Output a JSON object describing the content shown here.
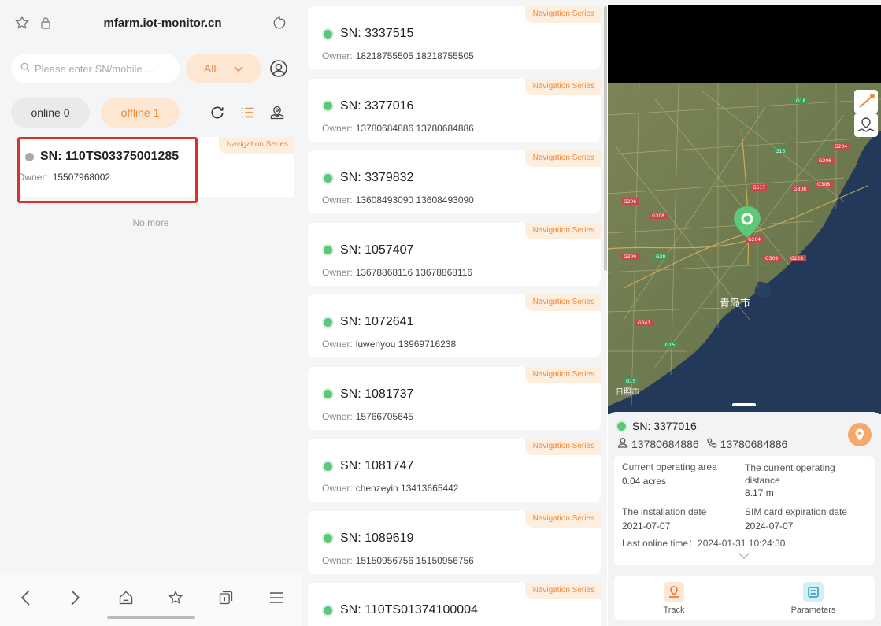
{
  "browser": {
    "url": "mfarm.iot-monitor.cn"
  },
  "search": {
    "placeholder": "Please enter SN/mobile ...",
    "filter_value": "All"
  },
  "filters": {
    "online_label": "online 0",
    "offline_label": "offline 1"
  },
  "selected_device": {
    "sn": "SN:  110TS03375001285",
    "owner_label": "Owner:",
    "owner_value": "15507968002",
    "tag": "Navigation Series"
  },
  "list_end_text": "No more",
  "device_list": [
    {
      "sn": "SN:  3337515",
      "owner_label": "Owner:",
      "owner_value": "18218755505 18218755505",
      "tag": "Navigation Series"
    },
    {
      "sn": "SN:  3377016",
      "owner_label": "Owner:",
      "owner_value": "13780684886 13780684886",
      "tag": "Navigation Series"
    },
    {
      "sn": "SN:  3379832",
      "owner_label": "Owner:",
      "owner_value": "13608493090 13608493090",
      "tag": "Navigation Series"
    },
    {
      "sn": "SN:  1057407",
      "owner_label": "Owner:",
      "owner_value": "13678868116 13678868116",
      "tag": "Navigation Series"
    },
    {
      "sn": "SN:  1072641",
      "owner_label": "Owner:",
      "owner_value": "luwenyou 13969716238",
      "tag": "Navigation Series"
    },
    {
      "sn": "SN:  1081737",
      "owner_label": "Owner:",
      "owner_value": "15766705645",
      "tag": "Navigation Series"
    },
    {
      "sn": "SN:  1081747",
      "owner_label": "Owner:",
      "owner_value": "chenzeyin 13413665442",
      "tag": "Navigation Series"
    },
    {
      "sn": "SN:  1089619",
      "owner_label": "Owner:",
      "owner_value": "15150956756 15150956756",
      "tag": "Navigation Series"
    },
    {
      "sn": "SN:  110TS01374100004",
      "owner_label": "",
      "owner_value": "",
      "tag": "Navigation Series"
    }
  ],
  "map": {
    "city_label": "青岛市",
    "city_label_2": "日照市",
    "road_labels": [
      "G18",
      "G15",
      "G204",
      "G206",
      "G517",
      "G308",
      "G308",
      "G206",
      "G308",
      "G204",
      "G309",
      "G20",
      "G309",
      "G228",
      "G341",
      "G15",
      "G15"
    ]
  },
  "device_detail": {
    "sn": "SN:  3377016",
    "owner_phone": "13780684886",
    "contact_phone": "13780684886",
    "area_label": "Current operating area",
    "area_value": "0.04 acres",
    "distance_label": "The current operating distance",
    "distance_value": "8.17 m",
    "install_label": "The installation date",
    "install_value": "2021-07-07",
    "sim_label": "SIM card expiration date",
    "sim_value": "2024-07-07",
    "last_online": "Last online time：2024-01-31 10:24:30",
    "track_label": "Track",
    "parameters_label": "Parameters"
  },
  "colors": {
    "accent": "#f08a3c",
    "accent_bg": "#fde6d2",
    "online": "#5ec87a",
    "highlight": "#d9322a"
  }
}
